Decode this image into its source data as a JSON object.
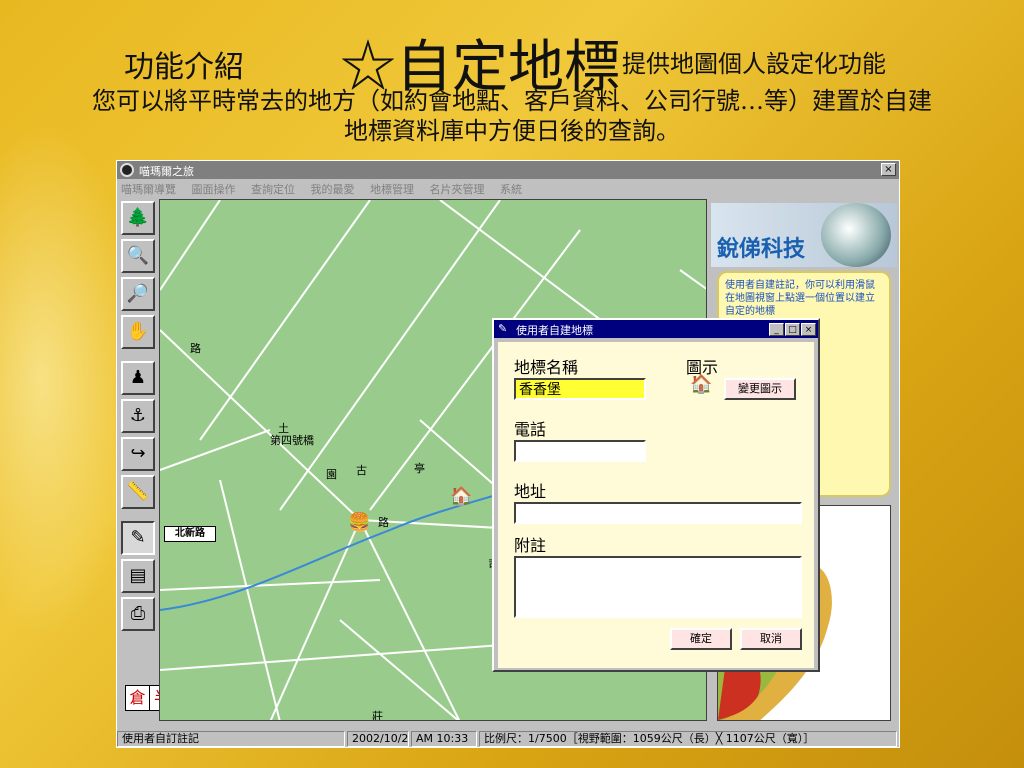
{
  "slide": {
    "section": "功能介紹",
    "title": "☆自定地標",
    "subtitle": "提供地圖個人設定化功能",
    "description_line1": "您可以將平時常去的地方（如約會地點、客戶資料、公司行號…等）建置於自建",
    "description_line2": "地標資料庫中方便日後的查詢。"
  },
  "window": {
    "title": "喵瑪爾之旅",
    "close": "×",
    "menu": [
      "喵瑪爾導覽",
      "圖面操作",
      "查詢定位",
      "我的最愛",
      "地標管理",
      "名片夾管理",
      "系統"
    ]
  },
  "map": {
    "labels": {
      "road1": "路",
      "place1": "土",
      "bridge": "第四號橋",
      "garden": "園",
      "ancient": "古",
      "pavilion": "亭",
      "road2": "路",
      "bottom": "莊",
      "cut": "司"
    },
    "station": "北新路"
  },
  "zoom": {
    "left": "倉",
    "right": "半"
  },
  "side_panel": {
    "logo": "銳俤科技",
    "info": "使用者自建註記，你可以利用滑鼠在地圖視窗上點選一個位置以建立自定的地標"
  },
  "status": {
    "mode": "使用者自訂註記",
    "date": "2002/10/2",
    "time": "AM 10:33",
    "scale": "比例尺：1/7500［視野範圍：1059公尺（長）╳ 1107公尺（寬）］"
  },
  "dialog": {
    "title": "使用者自建地標",
    "name_label": "地標名稱",
    "name_value": "香香堡",
    "icon_label": "圖示",
    "change_icon": "變更圖示",
    "phone_label": "電話",
    "phone_value": "",
    "address_label": "地址",
    "address_value": "",
    "note_label": "附註",
    "note_value": "",
    "ok": "確定",
    "cancel": "取消"
  },
  "colors": {
    "map_bg": "#99cc8c",
    "road": "#ffffff",
    "dialog_titlebar": "#00007f",
    "highlight_field": "#ffff33"
  }
}
